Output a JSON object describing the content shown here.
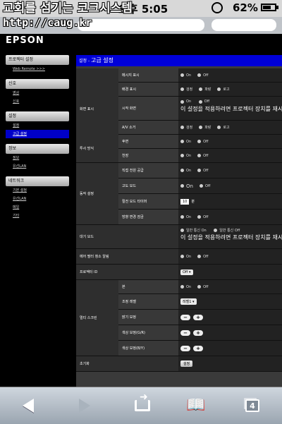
{
  "status": {
    "time": "오후 5:05",
    "battery": "62%"
  },
  "watermark": {
    "line1": "교회를 섬기는 코크시스템",
    "line2": "http://caug.kr"
  },
  "brand": "EPSON",
  "sidebar": [
    {
      "title": "프로젝터 설정",
      "items": [
        "Web Remote >>>"
      ]
    },
    {
      "title": "신호",
      "items": [
        "영상",
        "신호"
      ]
    },
    {
      "title": "설정",
      "items": [
        "설정",
        "고급 설정"
      ]
    },
    {
      "title": "정보",
      "items": [
        "정보",
        "유선LAN"
      ]
    },
    {
      "title": "네트워크",
      "items": [
        "기본 설정",
        "유선LAN",
        "메일",
        "기타"
      ]
    }
  ],
  "main": {
    "crumb": "설정 - ",
    "title": "고급 설정",
    "groups": [
      "화면 표시",
      "투사 방식",
      "동작 설정",
      "멀티 스크린"
    ],
    "labels": {
      "msg": "메시지 표시",
      "bg": "배경 표시",
      "start": "시작 화면",
      "av": "A/V 소거",
      "front": "후면",
      "ceil": "천장",
      "direct": "직접 전원 공급",
      "hialt": "고도 모드",
      "hialt_timer": "절전 모드 타이머",
      "keylock": "방향 변경 잠금",
      "standby": "대기 모드",
      "filter": "에어 필터 청소 알림",
      "projid": "프로젝터 ID",
      "multi_on": "본",
      "adj": "조정 레벨",
      "bright": "밝기 보정",
      "colorgr": "색상 보정(G/R)",
      "colorby": "색상 보정(B/Y)",
      "reset": "초기화"
    },
    "opts": {
      "on": "On",
      "off": "Off",
      "black": "검정",
      "blue": "파랑",
      "logo": "로고",
      "normal_on": "일반 통신 On",
      "normal_off": "일반 통신 Off"
    },
    "note": "이 설정을 적용하려면 프로젝터 장치를 재시",
    "timer_value": "10",
    "timer_unit": "분",
    "projid_value": "Off",
    "adj_value": "레벨1",
    "reset_btn": "설정",
    "minus": "−",
    "plus": "+"
  },
  "toolbar": {
    "tabs": "4"
  }
}
